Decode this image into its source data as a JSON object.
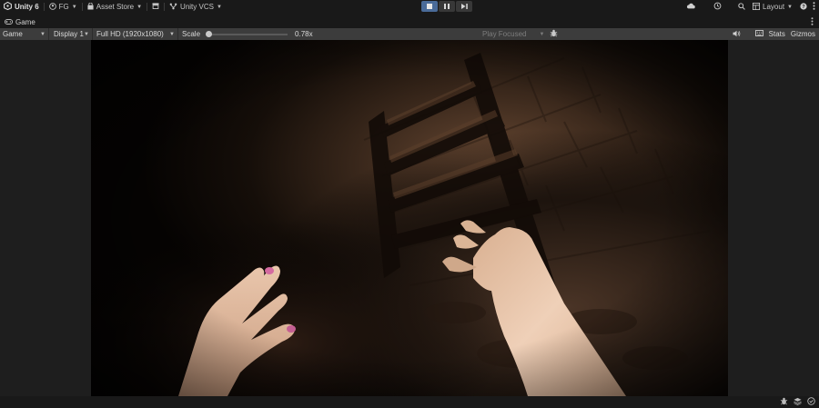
{
  "toolbar": {
    "product": "Unity 6",
    "account": "FG",
    "asset_store": "Asset Store",
    "vcs": "Unity VCS",
    "layout": "Layout",
    "play_state": "stopped",
    "icons": [
      "unity-logo-icon",
      "account-icon",
      "asset-store-icon",
      "package-icon",
      "vcs-icon",
      "play-icon",
      "pause-icon",
      "step-icon",
      "cloud-icon",
      "history-icon",
      "search-icon",
      "layout-icon",
      "help-icon",
      "more-icon"
    ]
  },
  "tab": {
    "label": "Game",
    "icon": "gamepad-icon"
  },
  "game_toolbar": {
    "view_mode": "Game",
    "display": "Display 1",
    "resolution": "Full HD (1920x1080)",
    "scale_label": "Scale",
    "scale_value": "0.78x",
    "scale_level": 0.0,
    "play_mode": "Play Focused",
    "stats": "Stats",
    "gizmos": "Gizmos"
  },
  "colors": {
    "toolbar_bg": "#191919",
    "gamebar_bg": "#3c3c3c",
    "active_play_button": "#4a6b99",
    "scene_bg": "#060403",
    "skin": "#e8c2a6",
    "nail": "#d46aa0"
  }
}
